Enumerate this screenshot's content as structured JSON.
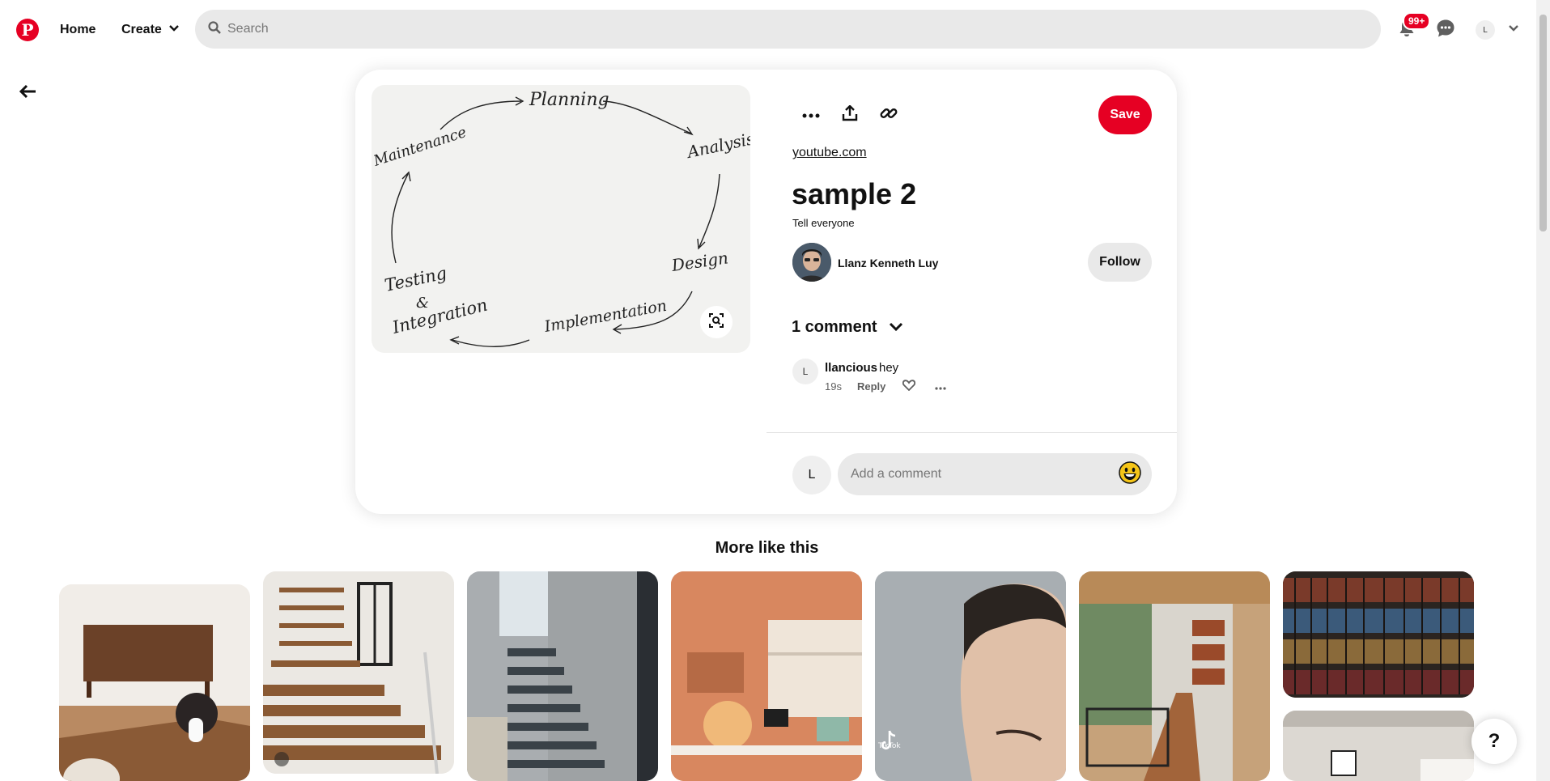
{
  "header": {
    "logo_letter": "P",
    "home_label": "Home",
    "create_label": "Create",
    "search_placeholder": "Search",
    "notification_badge": "99+",
    "account_initial": "L"
  },
  "pin": {
    "image_words": [
      "Planning",
      "Analysis",
      "Design",
      "Implementation",
      "Testing",
      "&",
      "Integration",
      "Maintenance"
    ],
    "save_label": "Save",
    "source": "youtube.com",
    "title": "sample 2",
    "description": "Tell everyone",
    "creator_name": "Llanz Kenneth Luy",
    "follow_label": "Follow",
    "comments_count_label": "1 comment"
  },
  "comments": [
    {
      "avatar_initial": "L",
      "author": "llancious",
      "text": "hey",
      "time": "19s",
      "reply_label": "Reply"
    }
  ],
  "composer": {
    "avatar_initial": "L",
    "placeholder": "Add a comment"
  },
  "more_like_this": {
    "heading": "More like this",
    "tiktok_label": "TikTok"
  },
  "help_label": "?",
  "colors": {
    "brand_red": "#e60023",
    "button_gray": "#e9e9e9"
  }
}
